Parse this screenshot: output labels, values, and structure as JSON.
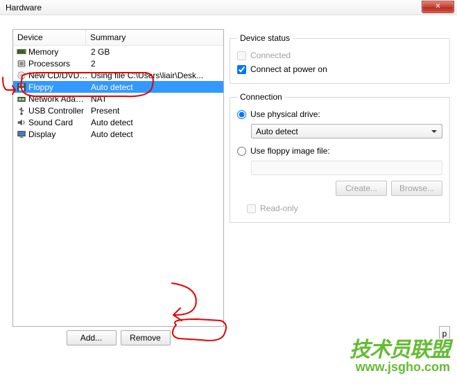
{
  "window": {
    "title": "Hardware"
  },
  "columns": {
    "device": "Device",
    "summary": "Summary"
  },
  "devices": [
    {
      "icon": "memory",
      "name": "Memory",
      "summary": "2 GB",
      "selected": false
    },
    {
      "icon": "cpu",
      "name": "Processors",
      "summary": "2",
      "selected": false
    },
    {
      "icon": "disc",
      "name": "New CD/DVD (...",
      "summary": "Using file C:\\Users\\liair\\Desk...",
      "selected": false
    },
    {
      "icon": "floppy",
      "name": "Floppy",
      "summary": "Auto detect",
      "selected": true
    },
    {
      "icon": "network",
      "name": "Network Adapter",
      "summary": "NAT",
      "selected": false
    },
    {
      "icon": "usb",
      "name": "USB Controller",
      "summary": "Present",
      "selected": false
    },
    {
      "icon": "sound",
      "name": "Sound Card",
      "summary": "Auto detect",
      "selected": false
    },
    {
      "icon": "display",
      "name": "Display",
      "summary": "Auto detect",
      "selected": false
    }
  ],
  "buttons": {
    "add": "Add...",
    "remove": "Remove"
  },
  "deviceStatus": {
    "legend": "Device status",
    "connected": "Connected",
    "connectPowerOn": "Connect at power on"
  },
  "connection": {
    "legend": "Connection",
    "usePhysical": "Use physical drive:",
    "physicalValue": "Auto detect",
    "useImage": "Use floppy image file:",
    "imagePath": "",
    "create": "Create...",
    "browse": "Browse...",
    "readonly": "Read-only"
  },
  "help": "p",
  "watermark": {
    "line1": "技术员联盟",
    "line2": "www.jsgho.com"
  }
}
